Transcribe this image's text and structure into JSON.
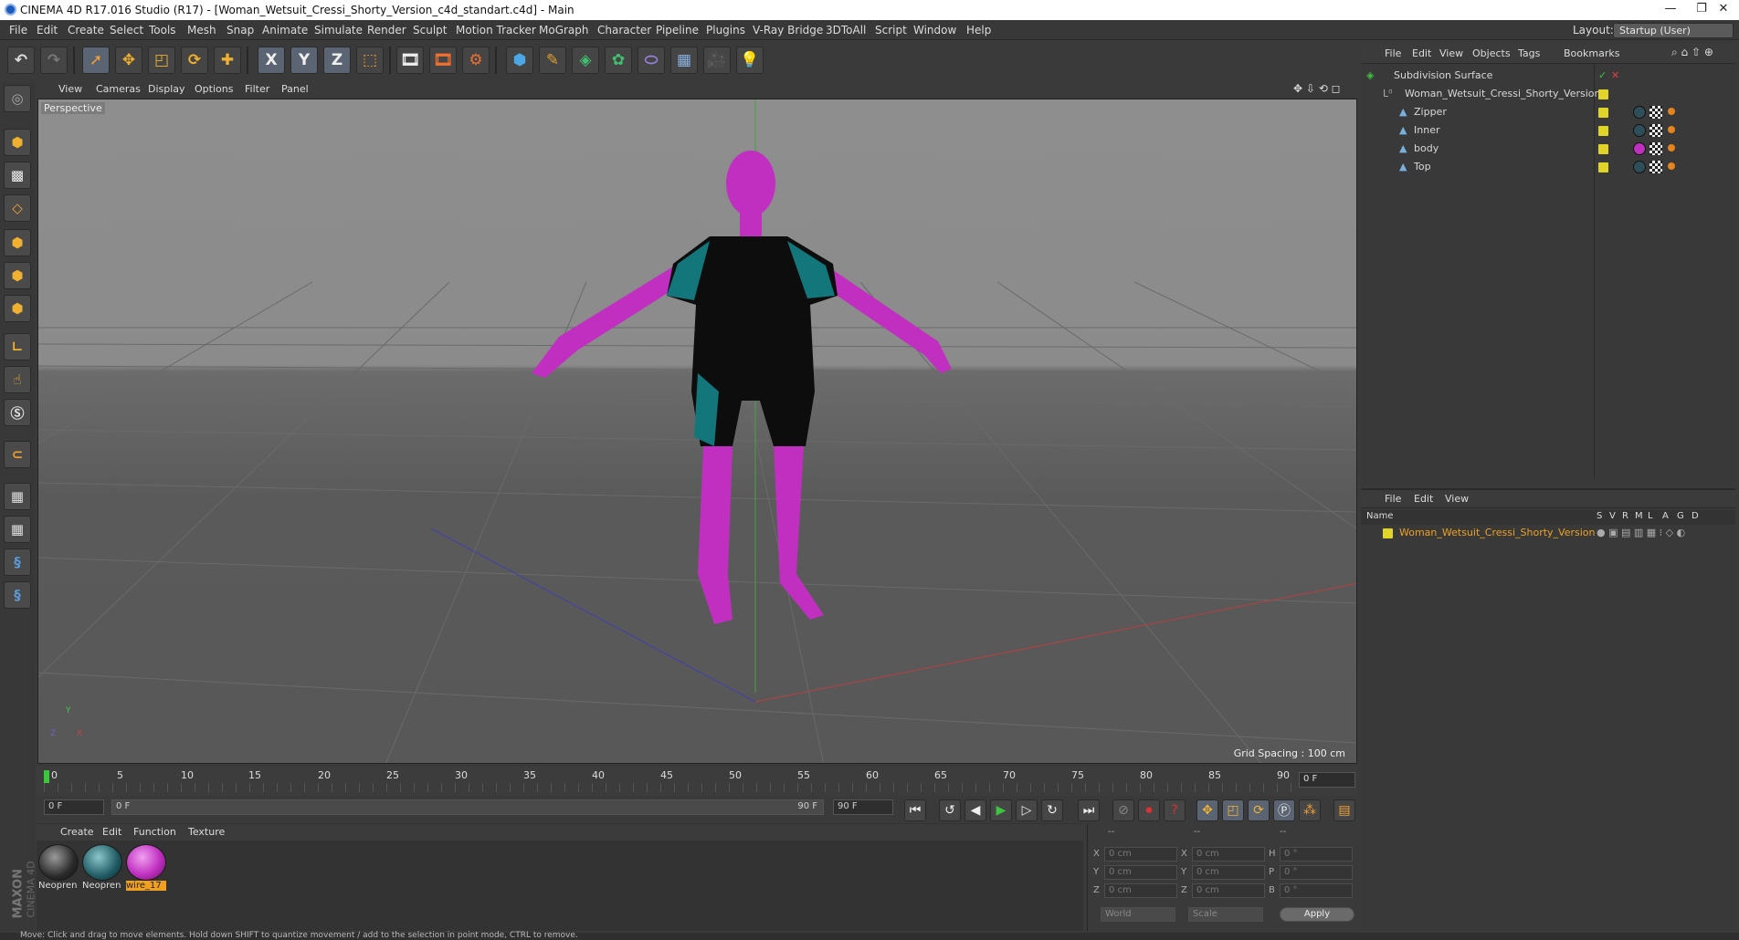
{
  "window": {
    "title": "CINEMA 4D R17.016 Studio (R17) - [Woman_Wetsuit_Cressi_Shorty_Version_c4d_standart.c4d] - Main",
    "controls": [
      "—",
      "❐",
      "✕"
    ]
  },
  "menubar": {
    "items": [
      "File",
      "Edit",
      "Create",
      "Select",
      "Tools",
      "Mesh",
      "Snap",
      "Animate",
      "Simulate",
      "Render",
      "Sculpt",
      "Motion Tracker",
      "MoGraph",
      "Character",
      "Pipeline",
      "Plugins",
      "V-Ray Bridge",
      "3DToAll",
      "Script",
      "Window",
      "Help"
    ],
    "layout_label": "Layout:",
    "layout_value": "Startup (User)"
  },
  "toolbar": {
    "buttons": [
      "undo-icon",
      "redo-icon",
      "select-icon",
      "move-icon",
      "scale-icon",
      "rotate-icon",
      "last-tool-icon",
      "x-axis-icon",
      "y-axis-icon",
      "z-axis-icon",
      "coord-system-icon",
      "render-view-icon",
      "render-picture-viewer-icon",
      "render-settings-icon",
      "cube-icon",
      "pen-spline-icon",
      "subdivision-icon",
      "cloner-icon",
      "deformer-icon",
      "floor-icon",
      "camera-icon",
      "light-icon"
    ],
    "axis_labels": [
      "X",
      "Y",
      "Z"
    ]
  },
  "viewport": {
    "menu": [
      "View",
      "Cameras",
      "Display",
      "Options",
      "Filter",
      "Panel"
    ],
    "label": "Perspective",
    "grid_spacing": "Grid Spacing : 100 cm",
    "axis": {
      "y": "Y",
      "x": "X",
      "z": "Z"
    }
  },
  "timeline": {
    "ticks": [
      "0",
      "5",
      "10",
      "15",
      "20",
      "25",
      "30",
      "35",
      "40",
      "45",
      "50",
      "55",
      "60",
      "65",
      "70",
      "75",
      "80",
      "85",
      "90"
    ],
    "current_frame": "0 F",
    "start_field": "0 F",
    "range_start": "0 F",
    "range_end": "90 F",
    "end_field": "90 F"
  },
  "materials": {
    "menu": [
      "Create",
      "Edit",
      "Function",
      "Texture"
    ],
    "items": [
      {
        "name": "Neopren",
        "color": "#3a3a3a"
      },
      {
        "name": "Neopren",
        "color": "#2e6a74"
      },
      {
        "name": "wire_17",
        "color": "#c030c0"
      }
    ]
  },
  "coordinates": {
    "headers": [
      "--",
      "--",
      "--"
    ],
    "rows": [
      {
        "a": "X",
        "av": "0 cm",
        "b": "X",
        "bv": "0 cm",
        "c": "H",
        "cv": "0 °"
      },
      {
        "a": "Y",
        "av": "0 cm",
        "b": "Y",
        "bv": "0 cm",
        "c": "P",
        "cv": "0 °"
      },
      {
        "a": "Z",
        "av": "0 cm",
        "b": "Z",
        "bv": "0 cm",
        "c": "B",
        "cv": "0 °"
      }
    ],
    "mode": "World",
    "scale": "Scale",
    "apply": "Apply"
  },
  "object_manager": {
    "menu": [
      "File",
      "Edit",
      "View",
      "Objects",
      "Tags",
      "Bookmarks"
    ],
    "objects": [
      {
        "name": "Subdivision Surface",
        "level": 0
      },
      {
        "name": "Woman_Wetsuit_Cressi_Shorty_Version",
        "level": 1
      },
      {
        "name": "Zipper",
        "level": 2
      },
      {
        "name": "Inner",
        "level": 2
      },
      {
        "name": "body",
        "level": 2
      },
      {
        "name": "Top",
        "level": 2
      }
    ]
  },
  "attribute_manager": {
    "menu": [
      "File",
      "Edit",
      "View"
    ],
    "columns": [
      "Name",
      "S",
      "V",
      "R",
      "M",
      "L",
      "A",
      "G",
      "D"
    ],
    "row": "Woman_Wetsuit_Cressi_Shorty_Version"
  },
  "brand": {
    "maxon": "MAXON",
    "cinema": "CINEMA 4D"
  },
  "status": "Move: Click and drag to move elements. Hold down SHIFT to quantize movement / add to the selection in point mode, CTRL to remove."
}
